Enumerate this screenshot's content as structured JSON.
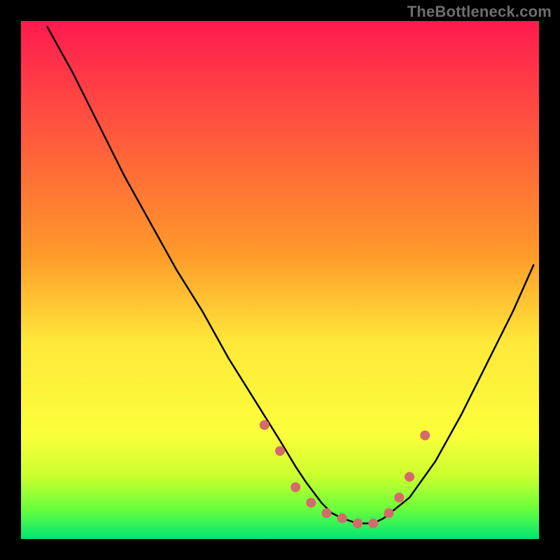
{
  "watermark": "TheBottleneck.com",
  "chart_data": {
    "type": "line",
    "title": "",
    "xlabel": "",
    "ylabel": "",
    "xlim": [
      0,
      100
    ],
    "ylim": [
      0,
      100
    ],
    "grid": false,
    "legend": false,
    "background_gradient": {
      "top": "#ff1a4f",
      "mid": "#ffe83a",
      "green_band_top": "#e2ff2e",
      "green_band_mid": "#8aff2e",
      "bottom": "#00e676"
    },
    "series": [
      {
        "name": "curve",
        "color": "#000000",
        "x": [
          5,
          10,
          15,
          20,
          25,
          30,
          35,
          40,
          45,
          50,
          53,
          55,
          58,
          60,
          62,
          65,
          68,
          70,
          75,
          80,
          85,
          90,
          95,
          99
        ],
        "y": [
          99,
          90,
          80,
          70,
          61,
          52,
          44,
          35,
          27,
          19,
          14,
          11,
          7,
          5,
          4,
          3,
          3,
          4,
          8,
          15,
          24,
          34,
          44,
          53
        ]
      }
    ],
    "marker_points": {
      "name": "dots",
      "color": "#d66a6a",
      "x": [
        47,
        50,
        53,
        56,
        59,
        62,
        65,
        68,
        71,
        73,
        75,
        78
      ],
      "y": [
        22,
        17,
        10,
        7,
        5,
        4,
        3,
        3,
        5,
        8,
        12,
        20
      ]
    }
  }
}
